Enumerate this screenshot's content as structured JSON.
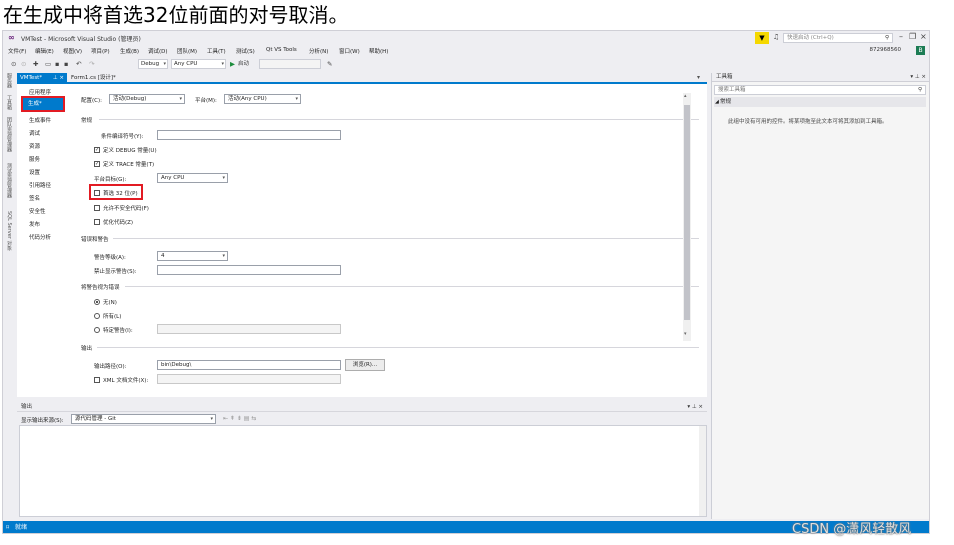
{
  "caption": "在生成中将首选32位前面的对号取消。",
  "window": {
    "title": "VMTest - Microsoft Visual Studio (管理员)",
    "quick_launch_placeholder": "快速启动 (Ctrl+Q)",
    "account": "872968560",
    "account_badge": "B"
  },
  "menu": [
    "文件(F)",
    "编辑(E)",
    "视图(V)",
    "项目(P)",
    "生成(B)",
    "调试(D)",
    "团队(M)",
    "工具(T)",
    "测试(S)",
    "Qt VS Tools",
    "分析(N)",
    "窗口(W)",
    "帮助(H)"
  ],
  "toolbar": {
    "config": "Debug",
    "platform": "Any CPU",
    "start_label": "启动"
  },
  "left_tabs": [
    "服务器资源管理器",
    "工具箱",
    "团队资源管理器",
    "测试资源管理器",
    "SQL Server 对象资源管理器"
  ],
  "doc_tabs": [
    {
      "label": "VMTest*",
      "active": true
    },
    {
      "label": "Form1.cs [设计]*",
      "active": false
    }
  ],
  "nav": {
    "items": [
      "应用程序",
      "生成*",
      "生成事件",
      "调试",
      "资源",
      "服务",
      "设置",
      "引用路径",
      "签名",
      "安全性",
      "发布",
      "代码分析"
    ],
    "selected_index": 1
  },
  "props": {
    "config_label": "配置(C):",
    "config_value": "活动(Debug)",
    "platform_label": "平台(M):",
    "platform_value": "活动(Any CPU)",
    "general_header": "常规",
    "cond_symbols_label": "条件编译符号(Y):",
    "cond_symbols_value": "",
    "define_debug_label": "定义 DEBUG 常量(U)",
    "define_debug": true,
    "define_trace_label": "定义 TRACE 常量(T)",
    "define_trace": true,
    "platform_target_label": "平台目标(G):",
    "platform_target_value": "Any CPU",
    "prefer32_label": "首选 32 位(P)",
    "prefer32": false,
    "unsafe_label": "允许不安全代码(F)",
    "unsafe": false,
    "optimize_label": "优化代码(Z)",
    "optimize": false,
    "errors_header": "错误和警告",
    "warning_level_label": "警告等级(A):",
    "warning_level_value": "4",
    "suppress_label": "禁止显示警告(S):",
    "suppress_value": "",
    "treat_header": "将警告视为错误",
    "treat_none_label": "无(N)",
    "treat_all_label": "所有(L)",
    "treat_specific_label": "特定警告(I):",
    "treat_selected": "none",
    "output_header": "输出",
    "output_path_label": "输出路径(O):",
    "output_path_value": "bin\\Debug\\",
    "browse_label": "浏览(R)...",
    "xml_doc_label": "XML 文档文件(X):",
    "xml_doc": false
  },
  "output_panel": {
    "title": "输出",
    "source_label": "显示输出来源(S):",
    "source_value": "源代码管理 - Git"
  },
  "toolbox": {
    "title": "工具箱",
    "search_placeholder": "搜索工具箱",
    "group": "常规",
    "empty_text": "此组中没有可用的控件。将某项拖至此文本可将其添加到工具箱。"
  },
  "status": {
    "text": "就绪"
  },
  "watermark": "CSDN @潇风轻散风"
}
